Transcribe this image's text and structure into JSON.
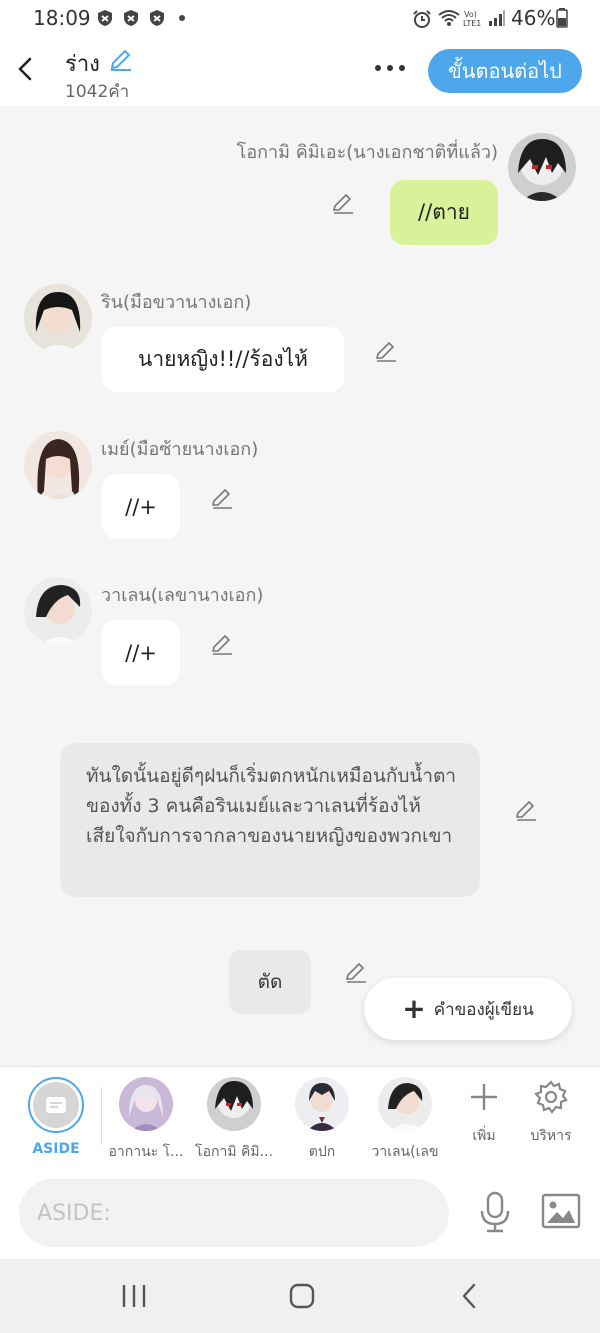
{
  "status_bar": {
    "time": "18:09",
    "battery": "46%"
  },
  "header": {
    "title": "ร่าง",
    "word_count": "1042คำ",
    "next_button": "ขั้นตอนต่อไป"
  },
  "messages": [
    {
      "speaker": "โอกามิ คิมิเอะ(นางเอกชาติที่แล้ว)",
      "text": "//ตาย",
      "side": "right",
      "color": "#d8f29a"
    },
    {
      "speaker": "ริน(มือขวานางเอก)",
      "text": "นายหญิง!!//ร้องไห้",
      "side": "left"
    },
    {
      "speaker": "เมย์(มือซ้ายนางเอก)",
      "text": "//+",
      "side": "left"
    },
    {
      "speaker": "วาเลน(เลขานางเอก)",
      "text": "//+",
      "side": "left"
    }
  ],
  "narration": "ทันใดนั้นอยู่ดีๆฝนก็เริ่มตกหนักเหมือนกับน้ำตาของทั้ง 3 คนคือรินเมย์และวาเลนที่ร้องไห้เสียใจกับการจากลาของนายหญิงของพวกเขา",
  "cut_label": "ตัด",
  "author_button": "คำของผู้เขียน",
  "character_bar": {
    "aside": "ASIDE",
    "characters": [
      "อากานะ โ...",
      "โอกามิ คิมิ...",
      "ตปก",
      "วาเลน(เลข"
    ],
    "add": "เพิ่ม",
    "manage": "บริหาร"
  },
  "input": {
    "placeholder": "ASIDE:"
  },
  "colors": {
    "accent": "#4ea7ea",
    "green_bubble": "#d8f29a",
    "aside_label": "#4ea7ea"
  }
}
